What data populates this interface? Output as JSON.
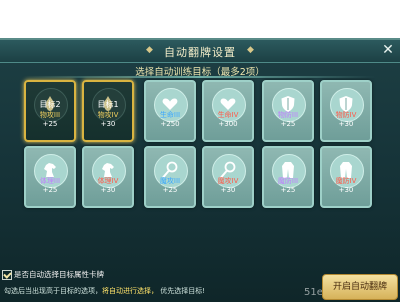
{
  "dialog": {
    "title": "自动翻牌设置",
    "subtitle": "选择自动训练目标（最多2项）",
    "close_symbol": "✕"
  },
  "cards": [
    {
      "name": "物攻III",
      "value": "+25",
      "tag": "目标2",
      "selected": true,
      "color": "yellow",
      "icon": "flame-icon"
    },
    {
      "name": "物攻IV",
      "value": "+30",
      "tag": "目标1",
      "selected": true,
      "color": "yellow",
      "icon": "flame-icon"
    },
    {
      "name": "生命III",
      "value": "+250",
      "tag": "",
      "selected": false,
      "color": "blue",
      "icon": "heart-icon"
    },
    {
      "name": "生命IV",
      "value": "+300",
      "tag": "",
      "selected": false,
      "color": "red",
      "icon": "heart-icon"
    },
    {
      "name": "物防III",
      "value": "+25",
      "tag": "",
      "selected": false,
      "color": "purple",
      "icon": "shield-icon"
    },
    {
      "name": "物防IV",
      "value": "+30",
      "tag": "",
      "selected": false,
      "color": "red",
      "icon": "shield-icon"
    },
    {
      "name": "体理III",
      "value": "+25",
      "tag": "",
      "selected": false,
      "color": "purple",
      "icon": "horse-icon"
    },
    {
      "name": "体理IV",
      "value": "+30",
      "tag": "",
      "selected": false,
      "color": "red",
      "icon": "horse-icon"
    },
    {
      "name": "魔攻III",
      "value": "+25",
      "tag": "",
      "selected": false,
      "color": "blue",
      "icon": "wand-icon"
    },
    {
      "name": "魔攻IV",
      "value": "+30",
      "tag": "",
      "selected": false,
      "color": "red",
      "icon": "wand-icon"
    },
    {
      "name": "魔防III",
      "value": "+25",
      "tag": "",
      "selected": false,
      "color": "purple",
      "icon": "robe-icon"
    },
    {
      "name": "魔防IV",
      "value": "+30",
      "tag": "",
      "selected": false,
      "color": "red",
      "icon": "robe-icon"
    }
  ],
  "footer": {
    "checkbox_label": "是否自动选择目标属性卡牌",
    "hint_prefix": "勾选后当出现高于目标的选项，",
    "hint_highlight": "将自动进行选择，",
    "hint_suffix": " 优先选择目标!",
    "button_label": "开启自动翻牌",
    "watermark": "51edu"
  }
}
